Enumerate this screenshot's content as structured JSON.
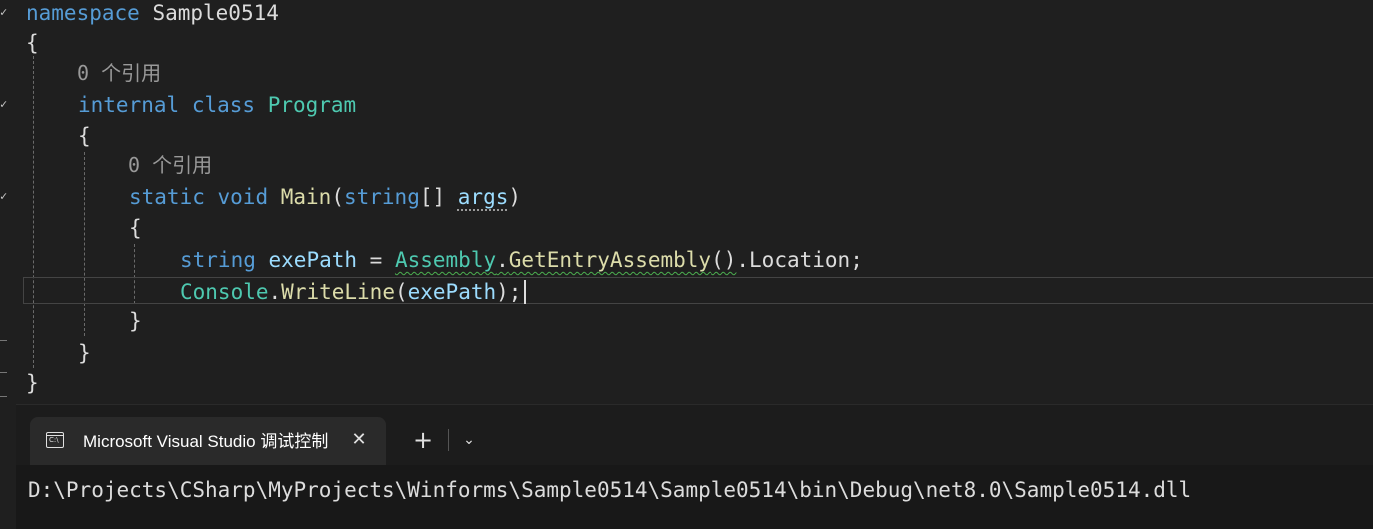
{
  "editor": {
    "code_lens": "0 个引用",
    "line_namespace": {
      "keyword": "namespace",
      "name": "Sample0514"
    },
    "brace_open": "{",
    "brace_close": "}",
    "line_class": {
      "modifier": "internal",
      "keyword": "class",
      "name": "Program"
    },
    "line_method": {
      "static": "static",
      "void": "void",
      "name": "Main",
      "open": "(",
      "param_type": "string",
      "brackets": "[] ",
      "param": "args",
      "close": ")"
    },
    "line_assign": {
      "type": "string",
      "var": "exePath",
      "eq": " = ",
      "class": "Assembly",
      "dot1": ".",
      "method": "GetEntryAssembly",
      "parens": "()",
      "dot2": ".",
      "prop": "Location",
      "semi": ";"
    },
    "line_write": {
      "class": "Console",
      "dot": ".",
      "method": "WriteLine",
      "open": "(",
      "arg": "exePath",
      "close": ");"
    }
  },
  "terminal": {
    "tab_title": "Microsoft Visual Studio 调试控制台",
    "tab_icon": "C:\\",
    "close_symbol": "✕",
    "new_tab_symbol": "+",
    "dropdown_symbol": "⌄",
    "output": "D:\\Projects\\CSharp\\MyProjects\\Winforms\\Sample0514\\Sample0514\\bin\\Debug\\net8.0\\Sample0514.dll"
  },
  "colors": {
    "background": "#1f1f1f",
    "keyword": "#569cd6",
    "type": "#4ec9b0",
    "method": "#dcdcaa",
    "parameter": "#9cdcfe"
  }
}
